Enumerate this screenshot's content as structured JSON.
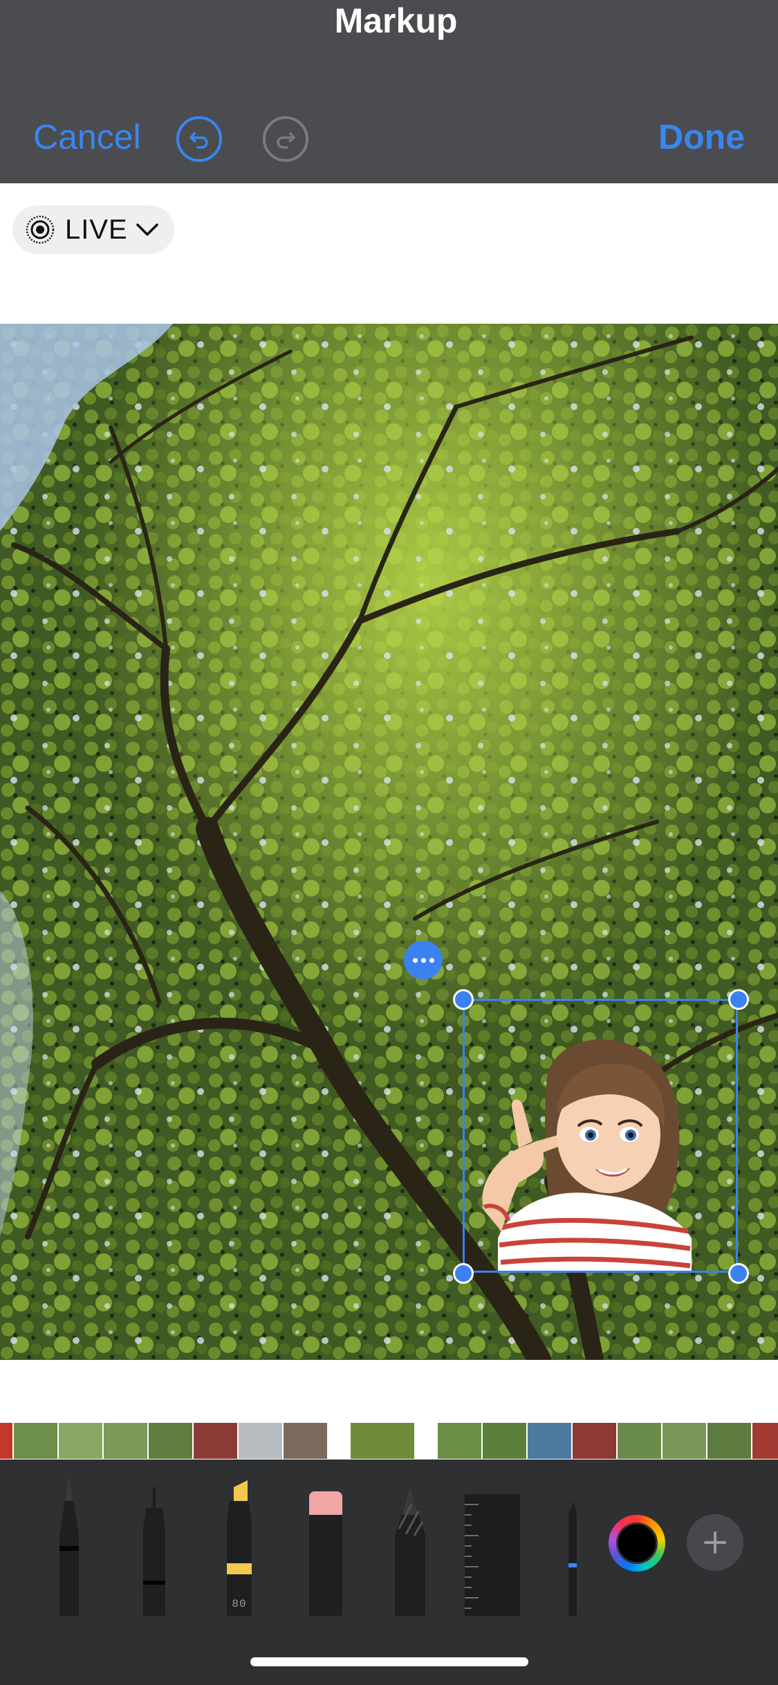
{
  "header": {
    "cancel_label": "Cancel",
    "title": "Markup",
    "done_label": "Done",
    "accent_color": "#3a86f0"
  },
  "live_photo": {
    "label": "LIVE",
    "icon": "live-photo-icon"
  },
  "photo": {
    "subject": "tree canopy from below",
    "sticker": "memoji-sticker"
  },
  "tools": {
    "highlighter_label": "80",
    "items": [
      "pen",
      "fine-pen",
      "highlighter",
      "eraser",
      "pencil",
      "ruler",
      "fountain-pen"
    ],
    "selected_color": "#000000"
  },
  "filmstrip": {
    "thumb_count": 17
  }
}
